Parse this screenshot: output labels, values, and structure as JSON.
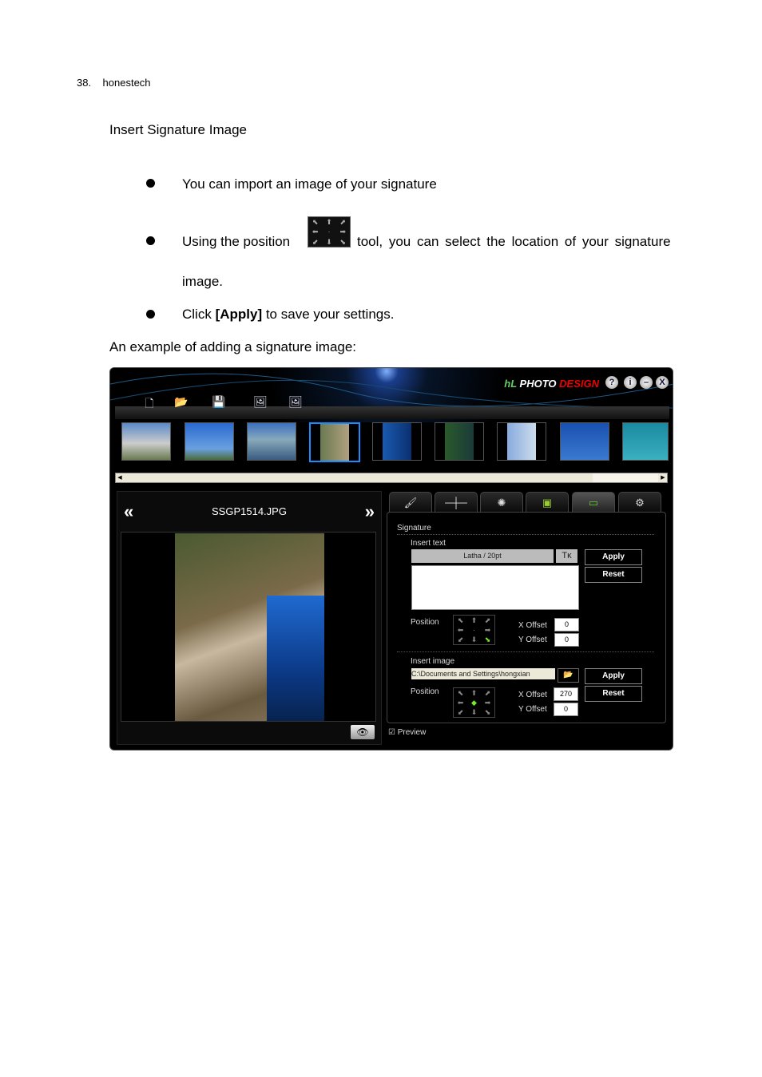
{
  "header": {
    "page_number": "38.",
    "brand": "honestech"
  },
  "section_title": "Insert Signature Image",
  "bullets": [
    {
      "text": "You can import an image of your signature"
    },
    {
      "before": "Using the position",
      "after": "tool, you can select the location of your signature",
      "cont": "image."
    },
    {
      "before": "Click ",
      "bold": "[Apply]",
      "after": " to save your settings."
    }
  ],
  "example_caption": "An example of adding a signature image:",
  "app": {
    "logo_a": "PHOTO",
    "logo_b": "DESIGN",
    "logo_mark": "hL",
    "window_buttons": [
      "?",
      "i",
      "–",
      "X"
    ],
    "toolbar_icons": [
      "new-file-icon",
      "open-folder-icon",
      "save-icon",
      "remove-photo-icon",
      "rotate-photo-icon"
    ],
    "thumbnail_count": 9,
    "selected_thumbnail": 4,
    "file_name": "SSGP1514.JPG",
    "prev": "«",
    "next": "»",
    "tabs": [
      "edit-icon",
      "adjust-slider-icon",
      "effects-icon",
      "frame-icon",
      "signature-icon",
      "settings-icon"
    ],
    "signature": {
      "title": "Signature",
      "insert_text": "Insert text",
      "font": "Latha / 20pt",
      "font_btn": "Tκ",
      "apply": "Apply",
      "reset": "Reset",
      "position": "Position",
      "x_offset_label": "X Offset",
      "y_offset_label": "Y Offset",
      "text_x": "0",
      "text_y": "0",
      "insert_image": "Insert image",
      "image_path": "C:\\Documents and Settings\\hongxian",
      "image_x": "270",
      "image_y": "0"
    },
    "preview": "Preview",
    "preview_checked": true
  }
}
